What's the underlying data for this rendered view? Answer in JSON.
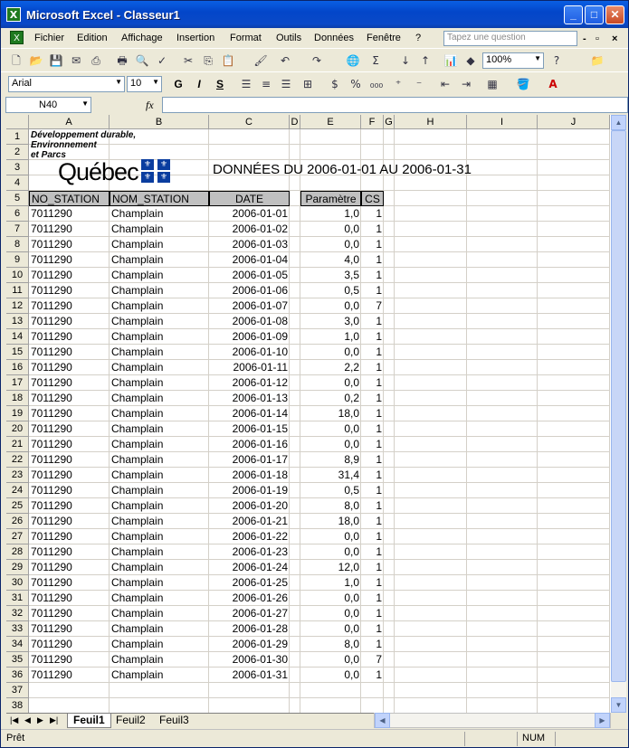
{
  "window": {
    "title": "Microsoft Excel - Classeur1",
    "controls": [
      "_",
      "□",
      "✕"
    ]
  },
  "menu": {
    "items": [
      "Fichier",
      "Edition",
      "Affichage",
      "Insertion",
      "Format",
      "Outils",
      "Données",
      "Fenêtre",
      "?"
    ],
    "ask_placeholder": "Tapez une question",
    "doc_controls": [
      "-",
      "▫",
      "×"
    ]
  },
  "toolbar": {
    "zoom": "100%",
    "font": "Arial",
    "size": "10",
    "bold": "G",
    "italic": "I",
    "underline": "S"
  },
  "formula": {
    "namebox": "N40",
    "fx": "fx",
    "value": ""
  },
  "sheet": {
    "columns": [
      "A",
      "B",
      "C",
      "D",
      "E",
      "F",
      "G",
      "H",
      "I",
      "J"
    ],
    "rows": [
      "1",
      "2",
      "3",
      "4",
      "5",
      "6",
      "7",
      "8",
      "9",
      "10",
      "11",
      "12",
      "13",
      "14",
      "15",
      "16",
      "17",
      "18",
      "19",
      "20",
      "21",
      "22",
      "23",
      "24",
      "25",
      "26",
      "27",
      "28",
      "29",
      "30",
      "31",
      "32",
      "33",
      "34",
      "35",
      "36",
      "37",
      "38"
    ],
    "logo_lines": [
      "Développement durable,",
      "Environnement",
      "et Parcs"
    ],
    "logo_word": "Québec",
    "title": "DONNÉES DU 2006-01-01 AU 2006-01-31",
    "headers": [
      "NO_STATION",
      "NOM_STATION",
      "DATE",
      "Paramètre",
      "CS"
    ],
    "data": [
      [
        "7011290",
        "Champlain",
        "2006-01-01",
        "1,0",
        "1"
      ],
      [
        "7011290",
        "Champlain",
        "2006-01-02",
        "0,0",
        "1"
      ],
      [
        "7011290",
        "Champlain",
        "2006-01-03",
        "0,0",
        "1"
      ],
      [
        "7011290",
        "Champlain",
        "2006-01-04",
        "4,0",
        "1"
      ],
      [
        "7011290",
        "Champlain",
        "2006-01-05",
        "3,5",
        "1"
      ],
      [
        "7011290",
        "Champlain",
        "2006-01-06",
        "0,5",
        "1"
      ],
      [
        "7011290",
        "Champlain",
        "2006-01-07",
        "0,0",
        "7"
      ],
      [
        "7011290",
        "Champlain",
        "2006-01-08",
        "3,0",
        "1"
      ],
      [
        "7011290",
        "Champlain",
        "2006-01-09",
        "1,0",
        "1"
      ],
      [
        "7011290",
        "Champlain",
        "2006-01-10",
        "0,0",
        "1"
      ],
      [
        "7011290",
        "Champlain",
        "2006-01-11",
        "2,2",
        "1"
      ],
      [
        "7011290",
        "Champlain",
        "2006-01-12",
        "0,0",
        "1"
      ],
      [
        "7011290",
        "Champlain",
        "2006-01-13",
        "0,2",
        "1"
      ],
      [
        "7011290",
        "Champlain",
        "2006-01-14",
        "18,0",
        "1"
      ],
      [
        "7011290",
        "Champlain",
        "2006-01-15",
        "0,0",
        "1"
      ],
      [
        "7011290",
        "Champlain",
        "2006-01-16",
        "0,0",
        "1"
      ],
      [
        "7011290",
        "Champlain",
        "2006-01-17",
        "8,9",
        "1"
      ],
      [
        "7011290",
        "Champlain",
        "2006-01-18",
        "31,4",
        "1"
      ],
      [
        "7011290",
        "Champlain",
        "2006-01-19",
        "0,5",
        "1"
      ],
      [
        "7011290",
        "Champlain",
        "2006-01-20",
        "8,0",
        "1"
      ],
      [
        "7011290",
        "Champlain",
        "2006-01-21",
        "18,0",
        "1"
      ],
      [
        "7011290",
        "Champlain",
        "2006-01-22",
        "0,0",
        "1"
      ],
      [
        "7011290",
        "Champlain",
        "2006-01-23",
        "0,0",
        "1"
      ],
      [
        "7011290",
        "Champlain",
        "2006-01-24",
        "12,0",
        "1"
      ],
      [
        "7011290",
        "Champlain",
        "2006-01-25",
        "1,0",
        "1"
      ],
      [
        "7011290",
        "Champlain",
        "2006-01-26",
        "0,0",
        "1"
      ],
      [
        "7011290",
        "Champlain",
        "2006-01-27",
        "0,0",
        "1"
      ],
      [
        "7011290",
        "Champlain",
        "2006-01-28",
        "0,0",
        "1"
      ],
      [
        "7011290",
        "Champlain",
        "2006-01-29",
        "8,0",
        "1"
      ],
      [
        "7011290",
        "Champlain",
        "2006-01-30",
        "0,0",
        "7"
      ],
      [
        "7011290",
        "Champlain",
        "2006-01-31",
        "0,0",
        "1"
      ]
    ],
    "tabs": [
      "Feuil1",
      "Feuil2",
      "Feuil3"
    ]
  },
  "status": {
    "ready": "Prêt",
    "num": "NUM"
  }
}
